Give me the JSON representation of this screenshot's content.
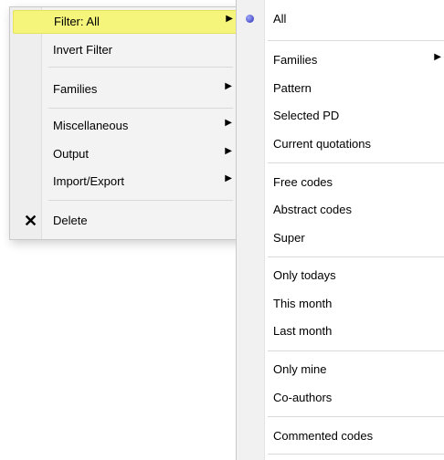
{
  "left_menu": {
    "items": [
      {
        "label": "Filter: All",
        "arrow": "▶"
      },
      {
        "label": "Invert Filter"
      },
      {
        "label": "Families",
        "arrow": "▶"
      },
      {
        "label": "Miscellaneous",
        "arrow": "▶"
      },
      {
        "label": "Output",
        "arrow": "▶"
      },
      {
        "label": "Import/Export",
        "arrow": "▶"
      },
      {
        "label": "Delete",
        "icon": "✕"
      }
    ]
  },
  "right_menu": {
    "items": [
      {
        "label": "All"
      },
      {
        "label": "Families",
        "arrow": "▶"
      },
      {
        "label": "Pattern"
      },
      {
        "label": "Selected PD"
      },
      {
        "label": "Current quotations"
      },
      {
        "label": "Free codes"
      },
      {
        "label": "Abstract codes"
      },
      {
        "label": "Super"
      },
      {
        "label": "Only todays"
      },
      {
        "label": "This month"
      },
      {
        "label": "Last month"
      },
      {
        "label": "Only mine"
      },
      {
        "label": "Co-authors"
      },
      {
        "label": "Commented codes"
      }
    ]
  },
  "colors": {
    "highlight": "#f4f57a",
    "radio": "#2a2fb0"
  }
}
